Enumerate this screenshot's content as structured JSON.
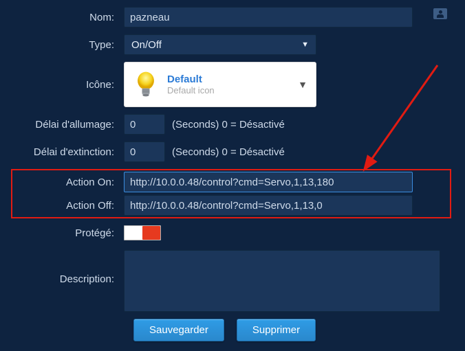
{
  "labels": {
    "nom": "Nom:",
    "type": "Type:",
    "icone": "Icône:",
    "delai_on": "Délai d'allumage:",
    "delai_off": "Délai d'extinction:",
    "action_on": "Action On:",
    "action_off": "Action Off:",
    "protege": "Protégé:",
    "description": "Description:"
  },
  "values": {
    "nom": "pazneau",
    "type": "On/Off",
    "delai_on": "0",
    "delai_off": "0",
    "action_on": "http://10.0.0.48/control?cmd=Servo,1,13,180",
    "action_off": "http://10.0.0.48/control?cmd=Servo,1,13,0",
    "description": ""
  },
  "hints": {
    "seconds": "(Seconds) 0 = Désactivé"
  },
  "icon": {
    "title": "Default",
    "subtitle": "Default icon"
  },
  "buttons": {
    "save": "Sauvegarder",
    "delete": "Supprimer"
  }
}
